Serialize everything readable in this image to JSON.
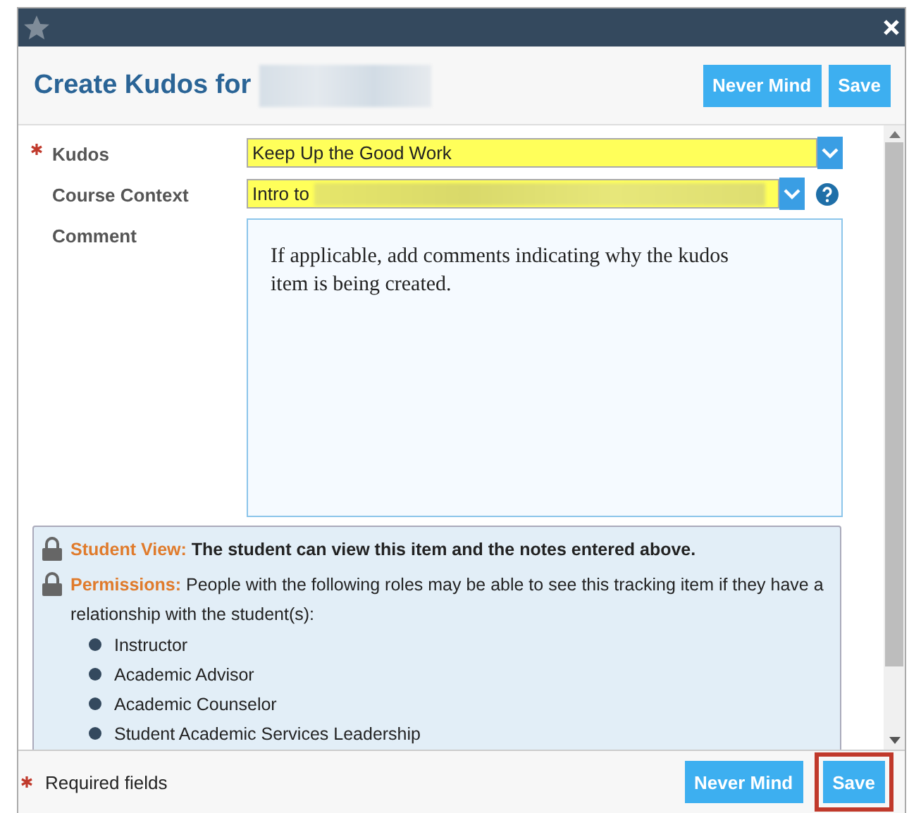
{
  "header": {
    "title": "Create Kudos for",
    "buttons": [
      "Never Mind",
      "Save"
    ]
  },
  "fields": [
    {
      "kind": "select",
      "label": "Kudos",
      "required": true,
      "value": "Keep Up the Good Work",
      "help": false
    },
    {
      "kind": "select",
      "label": "Course Context",
      "required": false,
      "value": "Intro to",
      "help": true
    },
    {
      "kind": "textarea",
      "label": "Comment",
      "required": false,
      "value": "If applicable, add comments indicating why the kudos item is being created."
    }
  ],
  "notices": [
    {
      "label": "Student View:",
      "text": "The student can view this item and the notes entered above.",
      "bold": true
    },
    {
      "label": "Permissions:",
      "text": "People with the following roles may be able to see this tracking item if they have a relationship with the student(s):",
      "bold": false,
      "roles": [
        "Instructor",
        "Academic Advisor",
        "Academic Counselor",
        "Student Academic Services Leadership"
      ]
    }
  ],
  "footer": {
    "required_note": "Required fields",
    "buttons": [
      {
        "label": "Never Mind",
        "highlighted": false
      },
      {
        "label": "Save",
        "highlighted": true
      }
    ]
  }
}
